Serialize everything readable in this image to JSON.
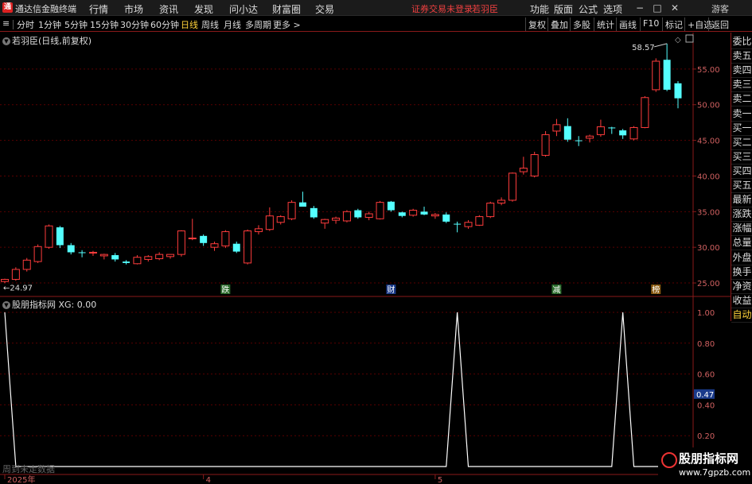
{
  "app": {
    "title": "通达信金融终端",
    "logo_char": "通",
    "menu": [
      "行情",
      "市场",
      "资讯",
      "发现",
      "问小达",
      "财富圈",
      "交易"
    ],
    "status_msg": "证券交易未登录",
    "account": "若羽臣",
    "right_menu": [
      "功能",
      "版面",
      "公式",
      "选项"
    ],
    "window_buttons": [
      "−",
      "□",
      "✕"
    ],
    "guest": "游客"
  },
  "periods": {
    "items": [
      "分时",
      "1分钟",
      "5分钟",
      "15分钟",
      "30分钟",
      "60分钟",
      "日线",
      "周线",
      "月线",
      "多周期",
      "更多 >"
    ],
    "active": "日线"
  },
  "toolbar_right": [
    "复权",
    "叠加",
    "多股",
    "统计",
    "画线",
    "F10",
    "标记",
    "+自选",
    "返回"
  ],
  "side_panel": {
    "items": [
      "委比",
      "卖五",
      "卖四",
      "卖三",
      "卖二",
      "卖一",
      "买一",
      "买二",
      "买三",
      "买四",
      "买五",
      "最新",
      "涨跌",
      "涨幅",
      "总量",
      "外盘",
      "换手",
      "净资",
      "收益"
    ],
    "auto": "自动"
  },
  "chart": {
    "title": "若羽臣(日线,前复权)",
    "high_label": "58.57",
    "low_label": "24.97",
    "event_markers": [
      "跌",
      "财",
      "减",
      "榜"
    ],
    "price_axis": [
      "55.00",
      "50.00",
      "45.00",
      "40.00",
      "35.00",
      "30.00",
      "25.00"
    ],
    "indicator_title": "股朋指标网",
    "indicator_value": "XG: 0.00",
    "indicator_axis": [
      "1.00",
      "0.80",
      "0.60",
      "0.40",
      "0.20"
    ],
    "indicator_current": "0.47",
    "no_data_text": "周到未走数据",
    "date_labels": [
      "2025年",
      "4",
      "5"
    ],
    "colors": {
      "up": "#ff3c3c",
      "down": "#54ffff",
      "grid": "#5a0000",
      "line": "#ffffff"
    }
  },
  "chart_data": {
    "type": "candlestick",
    "ylim": [
      24,
      59
    ],
    "candles": [
      {
        "o": 25.2,
        "h": 25.6,
        "l": 24.97,
        "c": 25.5
      },
      {
        "o": 25.5,
        "h": 27.2,
        "l": 25.3,
        "c": 26.9
      },
      {
        "o": 26.9,
        "h": 28.5,
        "l": 26.6,
        "c": 28.2
      },
      {
        "o": 28.0,
        "h": 30.4,
        "l": 27.8,
        "c": 30.1
      },
      {
        "o": 30.0,
        "h": 33.2,
        "l": 29.8,
        "c": 33.0
      },
      {
        "o": 32.8,
        "h": 33.0,
        "l": 29.9,
        "c": 30.3
      },
      {
        "o": 30.3,
        "h": 30.6,
        "l": 29.0,
        "c": 29.3
      },
      {
        "o": 29.3,
        "h": 29.6,
        "l": 28.6,
        "c": 29.2
      },
      {
        "o": 29.2,
        "h": 29.5,
        "l": 28.8,
        "c": 29.3
      },
      {
        "o": 28.8,
        "h": 29.1,
        "l": 28.3,
        "c": 29.0
      },
      {
        "o": 28.9,
        "h": 29.2,
        "l": 28.0,
        "c": 28.3
      },
      {
        "o": 28.0,
        "h": 28.2,
        "l": 27.6,
        "c": 27.8
      },
      {
        "o": 27.7,
        "h": 28.9,
        "l": 27.6,
        "c": 28.6
      },
      {
        "o": 28.3,
        "h": 28.9,
        "l": 28.0,
        "c": 28.7
      },
      {
        "o": 28.4,
        "h": 29.3,
        "l": 28.2,
        "c": 29.0
      },
      {
        "o": 28.7,
        "h": 29.0,
        "l": 28.4,
        "c": 29.0
      },
      {
        "o": 29.0,
        "h": 32.4,
        "l": 28.7,
        "c": 32.3
      },
      {
        "o": 31.2,
        "h": 34.0,
        "l": 31.0,
        "c": 31.3
      },
      {
        "o": 31.6,
        "h": 31.8,
        "l": 30.2,
        "c": 30.6
      },
      {
        "o": 30.0,
        "h": 30.8,
        "l": 29.5,
        "c": 30.5
      },
      {
        "o": 30.2,
        "h": 32.4,
        "l": 29.9,
        "c": 32.2
      },
      {
        "o": 30.5,
        "h": 30.8,
        "l": 29.2,
        "c": 29.4
      },
      {
        "o": 27.8,
        "h": 32.5,
        "l": 27.6,
        "c": 32.3
      },
      {
        "o": 32.2,
        "h": 33.1,
        "l": 31.8,
        "c": 32.6
      },
      {
        "o": 32.5,
        "h": 35.6,
        "l": 32.3,
        "c": 34.4
      },
      {
        "o": 33.5,
        "h": 34.5,
        "l": 33.2,
        "c": 34.3
      },
      {
        "o": 34.0,
        "h": 36.6,
        "l": 33.8,
        "c": 36.3
      },
      {
        "o": 36.3,
        "h": 37.8,
        "l": 35.8,
        "c": 35.7
      },
      {
        "o": 35.5,
        "h": 35.8,
        "l": 34.0,
        "c": 34.2
      },
      {
        "o": 33.4,
        "h": 34.0,
        "l": 32.6,
        "c": 33.9
      },
      {
        "o": 33.8,
        "h": 34.3,
        "l": 33.3,
        "c": 34.1
      },
      {
        "o": 33.7,
        "h": 35.2,
        "l": 33.5,
        "c": 35.0
      },
      {
        "o": 35.2,
        "h": 35.4,
        "l": 34.0,
        "c": 34.2
      },
      {
        "o": 34.2,
        "h": 35.0,
        "l": 33.8,
        "c": 34.7
      },
      {
        "o": 34.0,
        "h": 36.5,
        "l": 33.9,
        "c": 36.3
      },
      {
        "o": 36.4,
        "h": 36.5,
        "l": 35.0,
        "c": 35.2
      },
      {
        "o": 34.9,
        "h": 35.0,
        "l": 34.2,
        "c": 34.4
      },
      {
        "o": 34.5,
        "h": 35.4,
        "l": 34.3,
        "c": 35.2
      },
      {
        "o": 35.0,
        "h": 35.7,
        "l": 34.5,
        "c": 34.6
      },
      {
        "o": 34.4,
        "h": 34.8,
        "l": 34.0,
        "c": 34.6
      },
      {
        "o": 34.6,
        "h": 34.9,
        "l": 33.4,
        "c": 33.6
      },
      {
        "o": 33.3,
        "h": 33.6,
        "l": 32.1,
        "c": 33.2
      },
      {
        "o": 32.9,
        "h": 33.8,
        "l": 32.6,
        "c": 33.5
      },
      {
        "o": 33.1,
        "h": 34.5,
        "l": 33.0,
        "c": 34.3
      },
      {
        "o": 34.3,
        "h": 36.4,
        "l": 34.1,
        "c": 36.2
      },
      {
        "o": 36.2,
        "h": 37.0,
        "l": 35.9,
        "c": 36.6
      },
      {
        "o": 36.6,
        "h": 40.5,
        "l": 36.4,
        "c": 40.4
      },
      {
        "o": 40.6,
        "h": 42.7,
        "l": 40.2,
        "c": 41.1
      },
      {
        "o": 40.0,
        "h": 43.4,
        "l": 39.8,
        "c": 43.0
      },
      {
        "o": 42.9,
        "h": 46.3,
        "l": 42.7,
        "c": 45.8
      },
      {
        "o": 46.3,
        "h": 48.0,
        "l": 45.6,
        "c": 47.2
      },
      {
        "o": 47.0,
        "h": 48.1,
        "l": 44.8,
        "c": 45.1
      },
      {
        "o": 45.0,
        "h": 45.6,
        "l": 44.2,
        "c": 44.9
      },
      {
        "o": 45.3,
        "h": 45.8,
        "l": 44.7,
        "c": 45.6
      },
      {
        "o": 45.8,
        "h": 47.9,
        "l": 45.5,
        "c": 46.9
      },
      {
        "o": 46.8,
        "h": 46.9,
        "l": 45.9,
        "c": 46.7
      },
      {
        "o": 46.4,
        "h": 46.6,
        "l": 45.2,
        "c": 45.7
      },
      {
        "o": 45.2,
        "h": 47.0,
        "l": 45.0,
        "c": 46.8
      },
      {
        "o": 46.8,
        "h": 51.2,
        "l": 46.7,
        "c": 51.0
      },
      {
        "o": 52.1,
        "h": 56.5,
        "l": 51.8,
        "c": 56.1
      },
      {
        "o": 56.3,
        "h": 58.57,
        "l": 51.9,
        "c": 52.1
      },
      {
        "o": 53.0,
        "h": 53.3,
        "l": 49.5,
        "c": 50.9
      }
    ],
    "indicator": {
      "name": "XG",
      "ylim": [
        0,
        1
      ],
      "signal_indices": [
        0,
        41,
        56
      ],
      "signal_value": 1.0
    },
    "event_indices": [
      20,
      35,
      50,
      59
    ],
    "date_label_indices": [
      0,
      18,
      39
    ]
  }
}
